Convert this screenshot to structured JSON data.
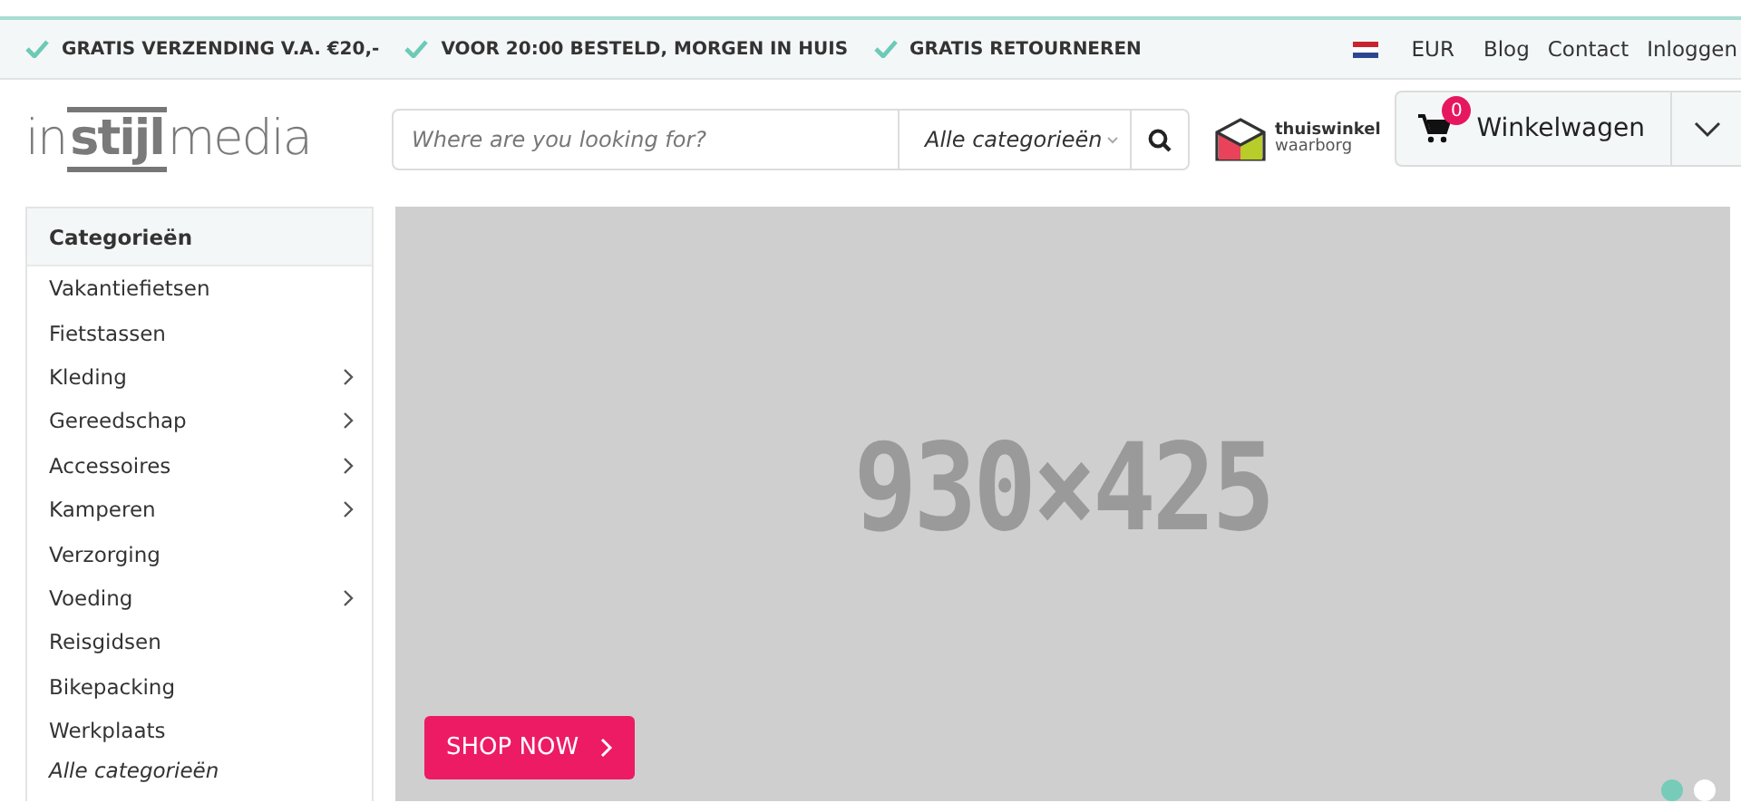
{
  "usp_bar": {
    "items": [
      "GRATIS VERZENDING V.A. €20,-",
      "VOOR 20:00 BESTELD, MORGEN IN HUIS",
      "GRATIS RETOURNEREN"
    ],
    "currency": "EUR",
    "links": [
      "Blog",
      "Contact",
      "Inloggen"
    ]
  },
  "header": {
    "logo": "in**stijl**media",
    "search": {
      "placeholder": "Where are you looking for?",
      "category": "Alle categorieën"
    },
    "trust_badge": {
      "line_1": "thuiswinkel",
      "line_2": "waarborg"
    },
    "cart": {
      "count": "0",
      "label": "Winkelwagen"
    }
  },
  "categories": {
    "title": "Categorieën",
    "items": [
      {
        "label": "Vakantiefietsen",
        "has_children": false
      },
      {
        "label": "Fietstassen",
        "has_children": false
      },
      {
        "label": "Kleding",
        "has_children": true
      },
      {
        "label": "Gereedschap",
        "has_children": true
      },
      {
        "label": "Accessoires",
        "has_children": true
      },
      {
        "label": "Kamperen",
        "has_children": true
      },
      {
        "label": "Verzorging",
        "has_children": false
      },
      {
        "label": "Voeding",
        "has_children": true
      },
      {
        "label": "Reisgidsen",
        "has_children": false
      },
      {
        "label": "Bikepacking",
        "has_children": false
      },
      {
        "label": "Werkplaats",
        "has_children": false
      }
    ],
    "all_link": "Alle categorieën"
  },
  "banner": {
    "placeholder_text": "930×425",
    "button": "SHOP NOW",
    "dots": [
      {
        "selected": true
      },
      {
        "selected": false
      }
    ]
  }
}
